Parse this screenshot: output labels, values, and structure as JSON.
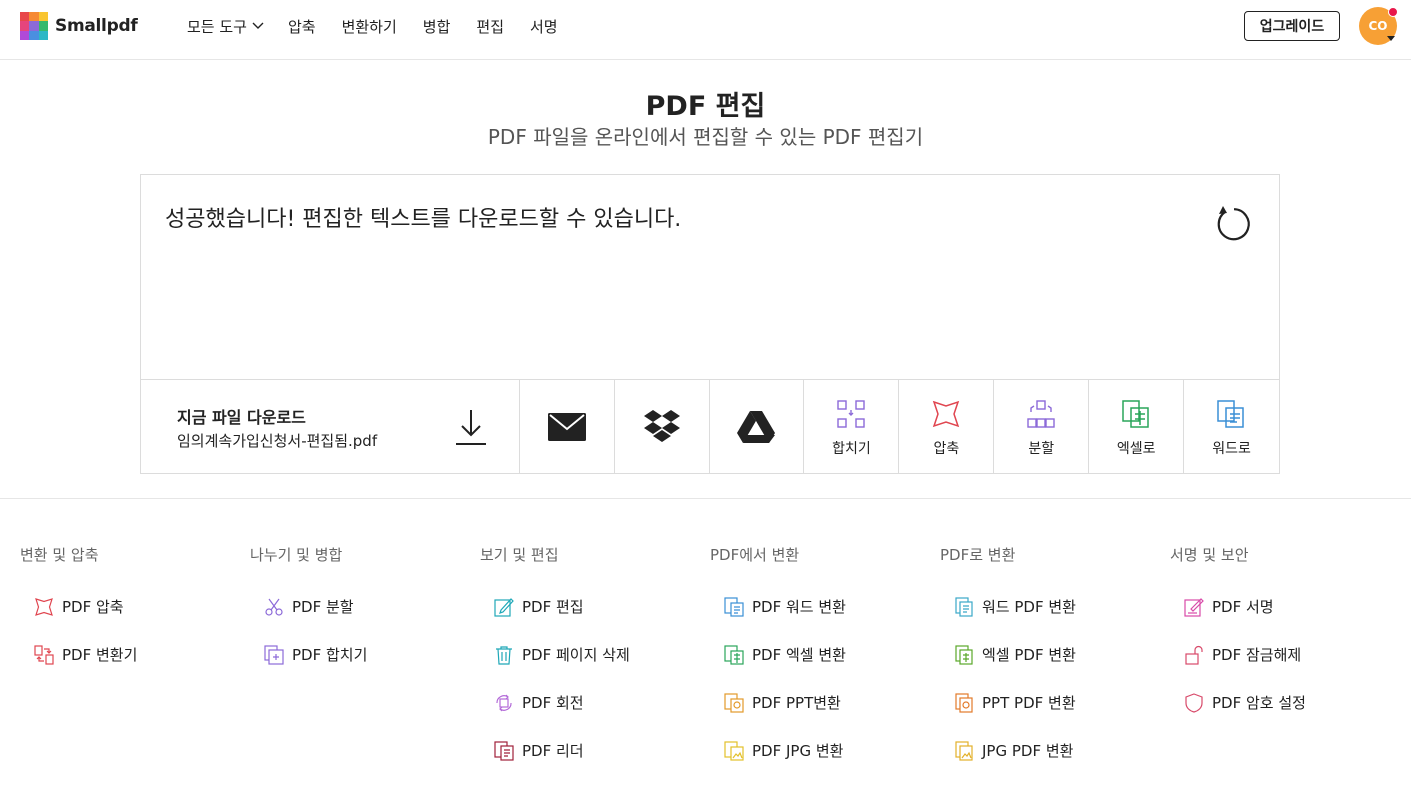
{
  "header": {
    "logo_text": "Smallpdf",
    "nav": [
      "모든 도구",
      "압축",
      "변환하기",
      "병합",
      "편집",
      "서명"
    ],
    "upgrade_label": "업그레이드",
    "avatar_initials": "CO"
  },
  "page": {
    "title": "PDF 편집",
    "subtitle": "PDF 파일을 온라인에서 편집할 수 있는 PDF 편집기"
  },
  "result": {
    "message": "성공했습니다! 편집한 텍스트를 다운로드할 수 있습니다.",
    "download_title": "지금 파일 다운로드",
    "file_name": "임의계속가입신청서-편집됨.pdf",
    "share_icons": [
      "email-icon",
      "dropbox-icon",
      "google-drive-icon"
    ],
    "tools": [
      {
        "label": "합치기",
        "icon": "merge-icon",
        "color": "#8c6ad8"
      },
      {
        "label": "압축",
        "icon": "compress-icon",
        "color": "#e0454f"
      },
      {
        "label": "분할",
        "icon": "split-icon",
        "color": "#8c6ad8"
      },
      {
        "label": "엑셀로",
        "icon": "excel-icon",
        "color": "#2aa55a"
      },
      {
        "label": "워드로",
        "icon": "word-icon",
        "color": "#3a8fd6"
      }
    ]
  },
  "footer": {
    "columns": [
      {
        "heading": "변환 및 압축",
        "items": [
          {
            "label": "PDF 압축",
            "icon": "compress-icon",
            "color": "#e0454f"
          },
          {
            "label": "PDF 변환기",
            "icon": "convert-icon",
            "color": "#e0454f"
          }
        ]
      },
      {
        "heading": "나누기 및 병합",
        "items": [
          {
            "label": "PDF 분할",
            "icon": "scissors-icon",
            "color": "#8c6ad8"
          },
          {
            "label": "PDF 합치기",
            "icon": "merge-icon",
            "color": "#8c6ad8"
          }
        ]
      },
      {
        "heading": "보기 및 편집",
        "items": [
          {
            "label": "PDF 편집",
            "icon": "edit-icon",
            "color": "#1fa8b8"
          },
          {
            "label": "PDF 페이지 삭제",
            "icon": "trash-icon",
            "color": "#1fa8b8"
          },
          {
            "label": "PDF 회전",
            "icon": "rotate-icon",
            "color": "#b36ad8"
          },
          {
            "label": "PDF 리더",
            "icon": "reader-icon",
            "color": "#a0203a"
          }
        ]
      },
      {
        "heading": "PDF에서 변환",
        "items": [
          {
            "label": "PDF 워드 변환",
            "icon": "word-icon",
            "color": "#3a8fd6"
          },
          {
            "label": "PDF 엑셀 변환",
            "icon": "excel-icon",
            "color": "#2aa55a"
          },
          {
            "label": "PDF PPT변환",
            "icon": "ppt-icon",
            "color": "#e39a2a"
          },
          {
            "label": "PDF JPG 변환",
            "icon": "jpg-icon",
            "color": "#e3c02a"
          }
        ]
      },
      {
        "heading": "PDF로 변환",
        "items": [
          {
            "label": "워드 PDF 변환",
            "icon": "word-doc-icon",
            "color": "#3aa8c8"
          },
          {
            "label": "엑셀 PDF 변환",
            "icon": "excel-doc-icon",
            "color": "#5aa82a"
          },
          {
            "label": "PPT PDF 변환",
            "icon": "ppt-doc-icon",
            "color": "#e37a2a"
          },
          {
            "label": "JPG PDF 변환",
            "icon": "jpg-doc-icon",
            "color": "#e3b02a"
          }
        ]
      },
      {
        "heading": "서명 및 보안",
        "items": [
          {
            "label": "PDF 서명",
            "icon": "sign-icon",
            "color": "#d84aa8"
          },
          {
            "label": "PDF 잠금해제",
            "icon": "unlock-icon",
            "color": "#d84a6a"
          },
          {
            "label": "PDF 암호 설정",
            "icon": "shield-icon",
            "color": "#d84a6a"
          }
        ]
      }
    ]
  }
}
